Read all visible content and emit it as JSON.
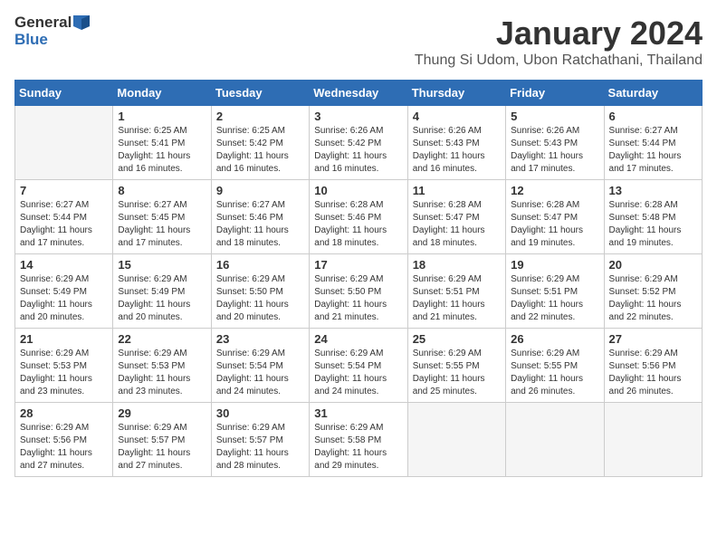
{
  "header": {
    "logo_general": "General",
    "logo_blue": "Blue",
    "month_title": "January 2024",
    "location": "Thung Si Udom, Ubon Ratchathani, Thailand"
  },
  "days_of_week": [
    "Sunday",
    "Monday",
    "Tuesday",
    "Wednesday",
    "Thursday",
    "Friday",
    "Saturday"
  ],
  "weeks": [
    [
      {
        "num": "",
        "empty": true
      },
      {
        "num": "1",
        "sunrise": "Sunrise: 6:25 AM",
        "sunset": "Sunset: 5:41 PM",
        "daylight": "Daylight: 11 hours and 16 minutes."
      },
      {
        "num": "2",
        "sunrise": "Sunrise: 6:25 AM",
        "sunset": "Sunset: 5:42 PM",
        "daylight": "Daylight: 11 hours and 16 minutes."
      },
      {
        "num": "3",
        "sunrise": "Sunrise: 6:26 AM",
        "sunset": "Sunset: 5:42 PM",
        "daylight": "Daylight: 11 hours and 16 minutes."
      },
      {
        "num": "4",
        "sunrise": "Sunrise: 6:26 AM",
        "sunset": "Sunset: 5:43 PM",
        "daylight": "Daylight: 11 hours and 16 minutes."
      },
      {
        "num": "5",
        "sunrise": "Sunrise: 6:26 AM",
        "sunset": "Sunset: 5:43 PM",
        "daylight": "Daylight: 11 hours and 17 minutes."
      },
      {
        "num": "6",
        "sunrise": "Sunrise: 6:27 AM",
        "sunset": "Sunset: 5:44 PM",
        "daylight": "Daylight: 11 hours and 17 minutes."
      }
    ],
    [
      {
        "num": "7",
        "sunrise": "Sunrise: 6:27 AM",
        "sunset": "Sunset: 5:44 PM",
        "daylight": "Daylight: 11 hours and 17 minutes."
      },
      {
        "num": "8",
        "sunrise": "Sunrise: 6:27 AM",
        "sunset": "Sunset: 5:45 PM",
        "daylight": "Daylight: 11 hours and 17 minutes."
      },
      {
        "num": "9",
        "sunrise": "Sunrise: 6:27 AM",
        "sunset": "Sunset: 5:46 PM",
        "daylight": "Daylight: 11 hours and 18 minutes."
      },
      {
        "num": "10",
        "sunrise": "Sunrise: 6:28 AM",
        "sunset": "Sunset: 5:46 PM",
        "daylight": "Daylight: 11 hours and 18 minutes."
      },
      {
        "num": "11",
        "sunrise": "Sunrise: 6:28 AM",
        "sunset": "Sunset: 5:47 PM",
        "daylight": "Daylight: 11 hours and 18 minutes."
      },
      {
        "num": "12",
        "sunrise": "Sunrise: 6:28 AM",
        "sunset": "Sunset: 5:47 PM",
        "daylight": "Daylight: 11 hours and 19 minutes."
      },
      {
        "num": "13",
        "sunrise": "Sunrise: 6:28 AM",
        "sunset": "Sunset: 5:48 PM",
        "daylight": "Daylight: 11 hours and 19 minutes."
      }
    ],
    [
      {
        "num": "14",
        "sunrise": "Sunrise: 6:29 AM",
        "sunset": "Sunset: 5:49 PM",
        "daylight": "Daylight: 11 hours and 20 minutes."
      },
      {
        "num": "15",
        "sunrise": "Sunrise: 6:29 AM",
        "sunset": "Sunset: 5:49 PM",
        "daylight": "Daylight: 11 hours and 20 minutes."
      },
      {
        "num": "16",
        "sunrise": "Sunrise: 6:29 AM",
        "sunset": "Sunset: 5:50 PM",
        "daylight": "Daylight: 11 hours and 20 minutes."
      },
      {
        "num": "17",
        "sunrise": "Sunrise: 6:29 AM",
        "sunset": "Sunset: 5:50 PM",
        "daylight": "Daylight: 11 hours and 21 minutes."
      },
      {
        "num": "18",
        "sunrise": "Sunrise: 6:29 AM",
        "sunset": "Sunset: 5:51 PM",
        "daylight": "Daylight: 11 hours and 21 minutes."
      },
      {
        "num": "19",
        "sunrise": "Sunrise: 6:29 AM",
        "sunset": "Sunset: 5:51 PM",
        "daylight": "Daylight: 11 hours and 22 minutes."
      },
      {
        "num": "20",
        "sunrise": "Sunrise: 6:29 AM",
        "sunset": "Sunset: 5:52 PM",
        "daylight": "Daylight: 11 hours and 22 minutes."
      }
    ],
    [
      {
        "num": "21",
        "sunrise": "Sunrise: 6:29 AM",
        "sunset": "Sunset: 5:53 PM",
        "daylight": "Daylight: 11 hours and 23 minutes."
      },
      {
        "num": "22",
        "sunrise": "Sunrise: 6:29 AM",
        "sunset": "Sunset: 5:53 PM",
        "daylight": "Daylight: 11 hours and 23 minutes."
      },
      {
        "num": "23",
        "sunrise": "Sunrise: 6:29 AM",
        "sunset": "Sunset: 5:54 PM",
        "daylight": "Daylight: 11 hours and 24 minutes."
      },
      {
        "num": "24",
        "sunrise": "Sunrise: 6:29 AM",
        "sunset": "Sunset: 5:54 PM",
        "daylight": "Daylight: 11 hours and 24 minutes."
      },
      {
        "num": "25",
        "sunrise": "Sunrise: 6:29 AM",
        "sunset": "Sunset: 5:55 PM",
        "daylight": "Daylight: 11 hours and 25 minutes."
      },
      {
        "num": "26",
        "sunrise": "Sunrise: 6:29 AM",
        "sunset": "Sunset: 5:55 PM",
        "daylight": "Daylight: 11 hours and 26 minutes."
      },
      {
        "num": "27",
        "sunrise": "Sunrise: 6:29 AM",
        "sunset": "Sunset: 5:56 PM",
        "daylight": "Daylight: 11 hours and 26 minutes."
      }
    ],
    [
      {
        "num": "28",
        "sunrise": "Sunrise: 6:29 AM",
        "sunset": "Sunset: 5:56 PM",
        "daylight": "Daylight: 11 hours and 27 minutes."
      },
      {
        "num": "29",
        "sunrise": "Sunrise: 6:29 AM",
        "sunset": "Sunset: 5:57 PM",
        "daylight": "Daylight: 11 hours and 27 minutes."
      },
      {
        "num": "30",
        "sunrise": "Sunrise: 6:29 AM",
        "sunset": "Sunset: 5:57 PM",
        "daylight": "Daylight: 11 hours and 28 minutes."
      },
      {
        "num": "31",
        "sunrise": "Sunrise: 6:29 AM",
        "sunset": "Sunset: 5:58 PM",
        "daylight": "Daylight: 11 hours and 29 minutes."
      },
      {
        "num": "",
        "empty": true
      },
      {
        "num": "",
        "empty": true
      },
      {
        "num": "",
        "empty": true
      }
    ]
  ]
}
